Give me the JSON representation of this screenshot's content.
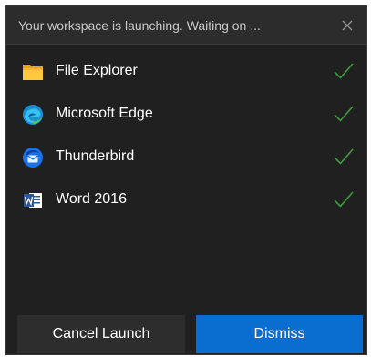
{
  "dialog": {
    "title": "Your workspace is launching. Waiting on ...",
    "close_icon": "close-icon",
    "apps": [
      {
        "name": "File Explorer",
        "icon": "file-explorer-icon",
        "status": "launched",
        "status_icon": "checkmark-icon"
      },
      {
        "name": "Microsoft Edge",
        "icon": "microsoft-edge-icon",
        "status": "launched",
        "status_icon": "checkmark-icon"
      },
      {
        "name": "Thunderbird",
        "icon": "thunderbird-icon",
        "status": "launched",
        "status_icon": "checkmark-icon"
      },
      {
        "name": "Word 2016",
        "icon": "word-icon",
        "status": "launched",
        "status_icon": "checkmark-icon"
      }
    ],
    "buttons": {
      "cancel_label": "Cancel Launch",
      "dismiss_label": "Dismiss"
    }
  },
  "colors": {
    "background": "#202020",
    "titlebar": "#2c2c2c",
    "accent": "#0a6ed1",
    "check": "#3d9a3d",
    "secondary_button": "#2d2d2d"
  }
}
